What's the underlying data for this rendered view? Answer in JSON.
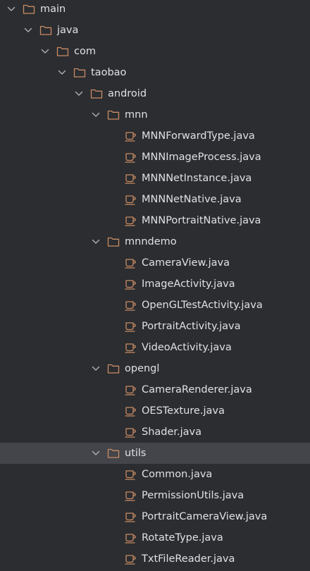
{
  "tree": {
    "items": [
      {
        "label": "main",
        "kind": "folder",
        "expanded": true,
        "depth": 0,
        "icon": "folder-icon"
      },
      {
        "label": "java",
        "kind": "folder",
        "expanded": true,
        "depth": 1,
        "icon": "folder-icon"
      },
      {
        "label": "com",
        "kind": "folder",
        "expanded": true,
        "depth": 2,
        "icon": "folder-icon"
      },
      {
        "label": "taobao",
        "kind": "folder",
        "expanded": true,
        "depth": 3,
        "icon": "folder-icon"
      },
      {
        "label": "android",
        "kind": "folder",
        "expanded": true,
        "depth": 4,
        "icon": "folder-icon"
      },
      {
        "label": "mnn",
        "kind": "folder",
        "expanded": true,
        "depth": 5,
        "icon": "folder-icon"
      },
      {
        "label": "MNNForwardType.java",
        "kind": "file",
        "depth": 6,
        "icon": "java-file-icon"
      },
      {
        "label": "MNNImageProcess.java",
        "kind": "file",
        "depth": 6,
        "icon": "java-file-icon"
      },
      {
        "label": "MNNNetInstance.java",
        "kind": "file",
        "depth": 6,
        "icon": "java-file-icon"
      },
      {
        "label": "MNNNetNative.java",
        "kind": "file",
        "depth": 6,
        "icon": "java-file-icon"
      },
      {
        "label": "MNNPortraitNative.java",
        "kind": "file",
        "depth": 6,
        "icon": "java-file-icon"
      },
      {
        "label": "mnndemo",
        "kind": "folder",
        "expanded": true,
        "depth": 5,
        "icon": "folder-icon"
      },
      {
        "label": "CameraView.java",
        "kind": "file",
        "depth": 6,
        "icon": "java-file-icon"
      },
      {
        "label": "ImageActivity.java",
        "kind": "file",
        "depth": 6,
        "icon": "java-file-icon"
      },
      {
        "label": "OpenGLTestActivity.java",
        "kind": "file",
        "depth": 6,
        "icon": "java-file-icon"
      },
      {
        "label": "PortraitActivity.java",
        "kind": "file",
        "depth": 6,
        "icon": "java-file-icon"
      },
      {
        "label": "VideoActivity.java",
        "kind": "file",
        "depth": 6,
        "icon": "java-file-icon"
      },
      {
        "label": "opengl",
        "kind": "folder",
        "expanded": true,
        "depth": 5,
        "icon": "folder-icon"
      },
      {
        "label": "CameraRenderer.java",
        "kind": "file",
        "depth": 6,
        "icon": "java-file-icon"
      },
      {
        "label": "OESTexture.java",
        "kind": "file",
        "depth": 6,
        "icon": "java-file-icon"
      },
      {
        "label": "Shader.java",
        "kind": "file",
        "depth": 6,
        "icon": "java-file-icon"
      },
      {
        "label": "utils",
        "kind": "folder",
        "expanded": true,
        "depth": 5,
        "icon": "folder-icon",
        "selected": true
      },
      {
        "label": "Common.java",
        "kind": "file",
        "depth": 6,
        "icon": "java-file-icon"
      },
      {
        "label": "PermissionUtils.java",
        "kind": "file",
        "depth": 6,
        "icon": "java-file-icon"
      },
      {
        "label": "PortraitCameraView.java",
        "kind": "file",
        "depth": 6,
        "icon": "java-file-icon"
      },
      {
        "label": "RotateType.java",
        "kind": "file",
        "depth": 6,
        "icon": "java-file-icon"
      },
      {
        "label": "TxtFileReader.java",
        "kind": "file",
        "depth": 6,
        "icon": "java-file-icon"
      }
    ]
  },
  "colors": {
    "background": "#2b2d30",
    "selected_row": "#43454a",
    "text": "#dfe1e5",
    "icon_stroke": "#c98c64",
    "chevron": "#aeb2b8"
  }
}
